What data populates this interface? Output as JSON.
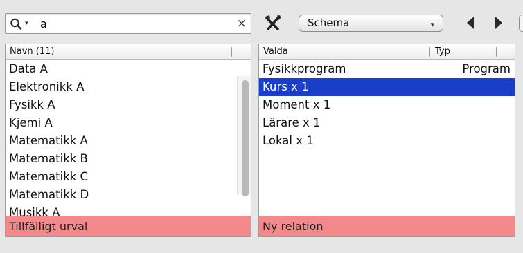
{
  "search": {
    "value": "a",
    "clear_icon": "×",
    "dropdown_caret": "▾"
  },
  "toolbar": {
    "schema_label": "Schema",
    "schema_arrow": "▾"
  },
  "left_list": {
    "header": "Navn (11)",
    "items": [
      "Data A",
      "Elektronikk A",
      "Fysikk A",
      "Kjemi A",
      "Matematikk A",
      "Matematikk B",
      "Matematikk C",
      "Matematikk D",
      "Musikk A"
    ],
    "footer": "Tillfälligt urval"
  },
  "right_list": {
    "header_col1": "Valda",
    "header_col2": "Typ",
    "rows": [
      {
        "name": "Fysikkprogram",
        "type": "Program"
      },
      {
        "name": "Kurs x 1",
        "type": ""
      },
      {
        "name": "Moment x 1",
        "type": ""
      },
      {
        "name": "Lärare x 1",
        "type": ""
      },
      {
        "name": "Lokal x 1",
        "type": ""
      }
    ],
    "selected_index": 1,
    "footer": "Ny relation"
  },
  "colors": {
    "selection": "#1a3ec8",
    "footer_background": "#f4898b",
    "window_background": "#e6e6e6"
  },
  "icons": {
    "search": "magnifier-icon",
    "tool": "cross-tools-icon",
    "prev": "triangle-left-icon",
    "next": "triangle-right-icon"
  }
}
